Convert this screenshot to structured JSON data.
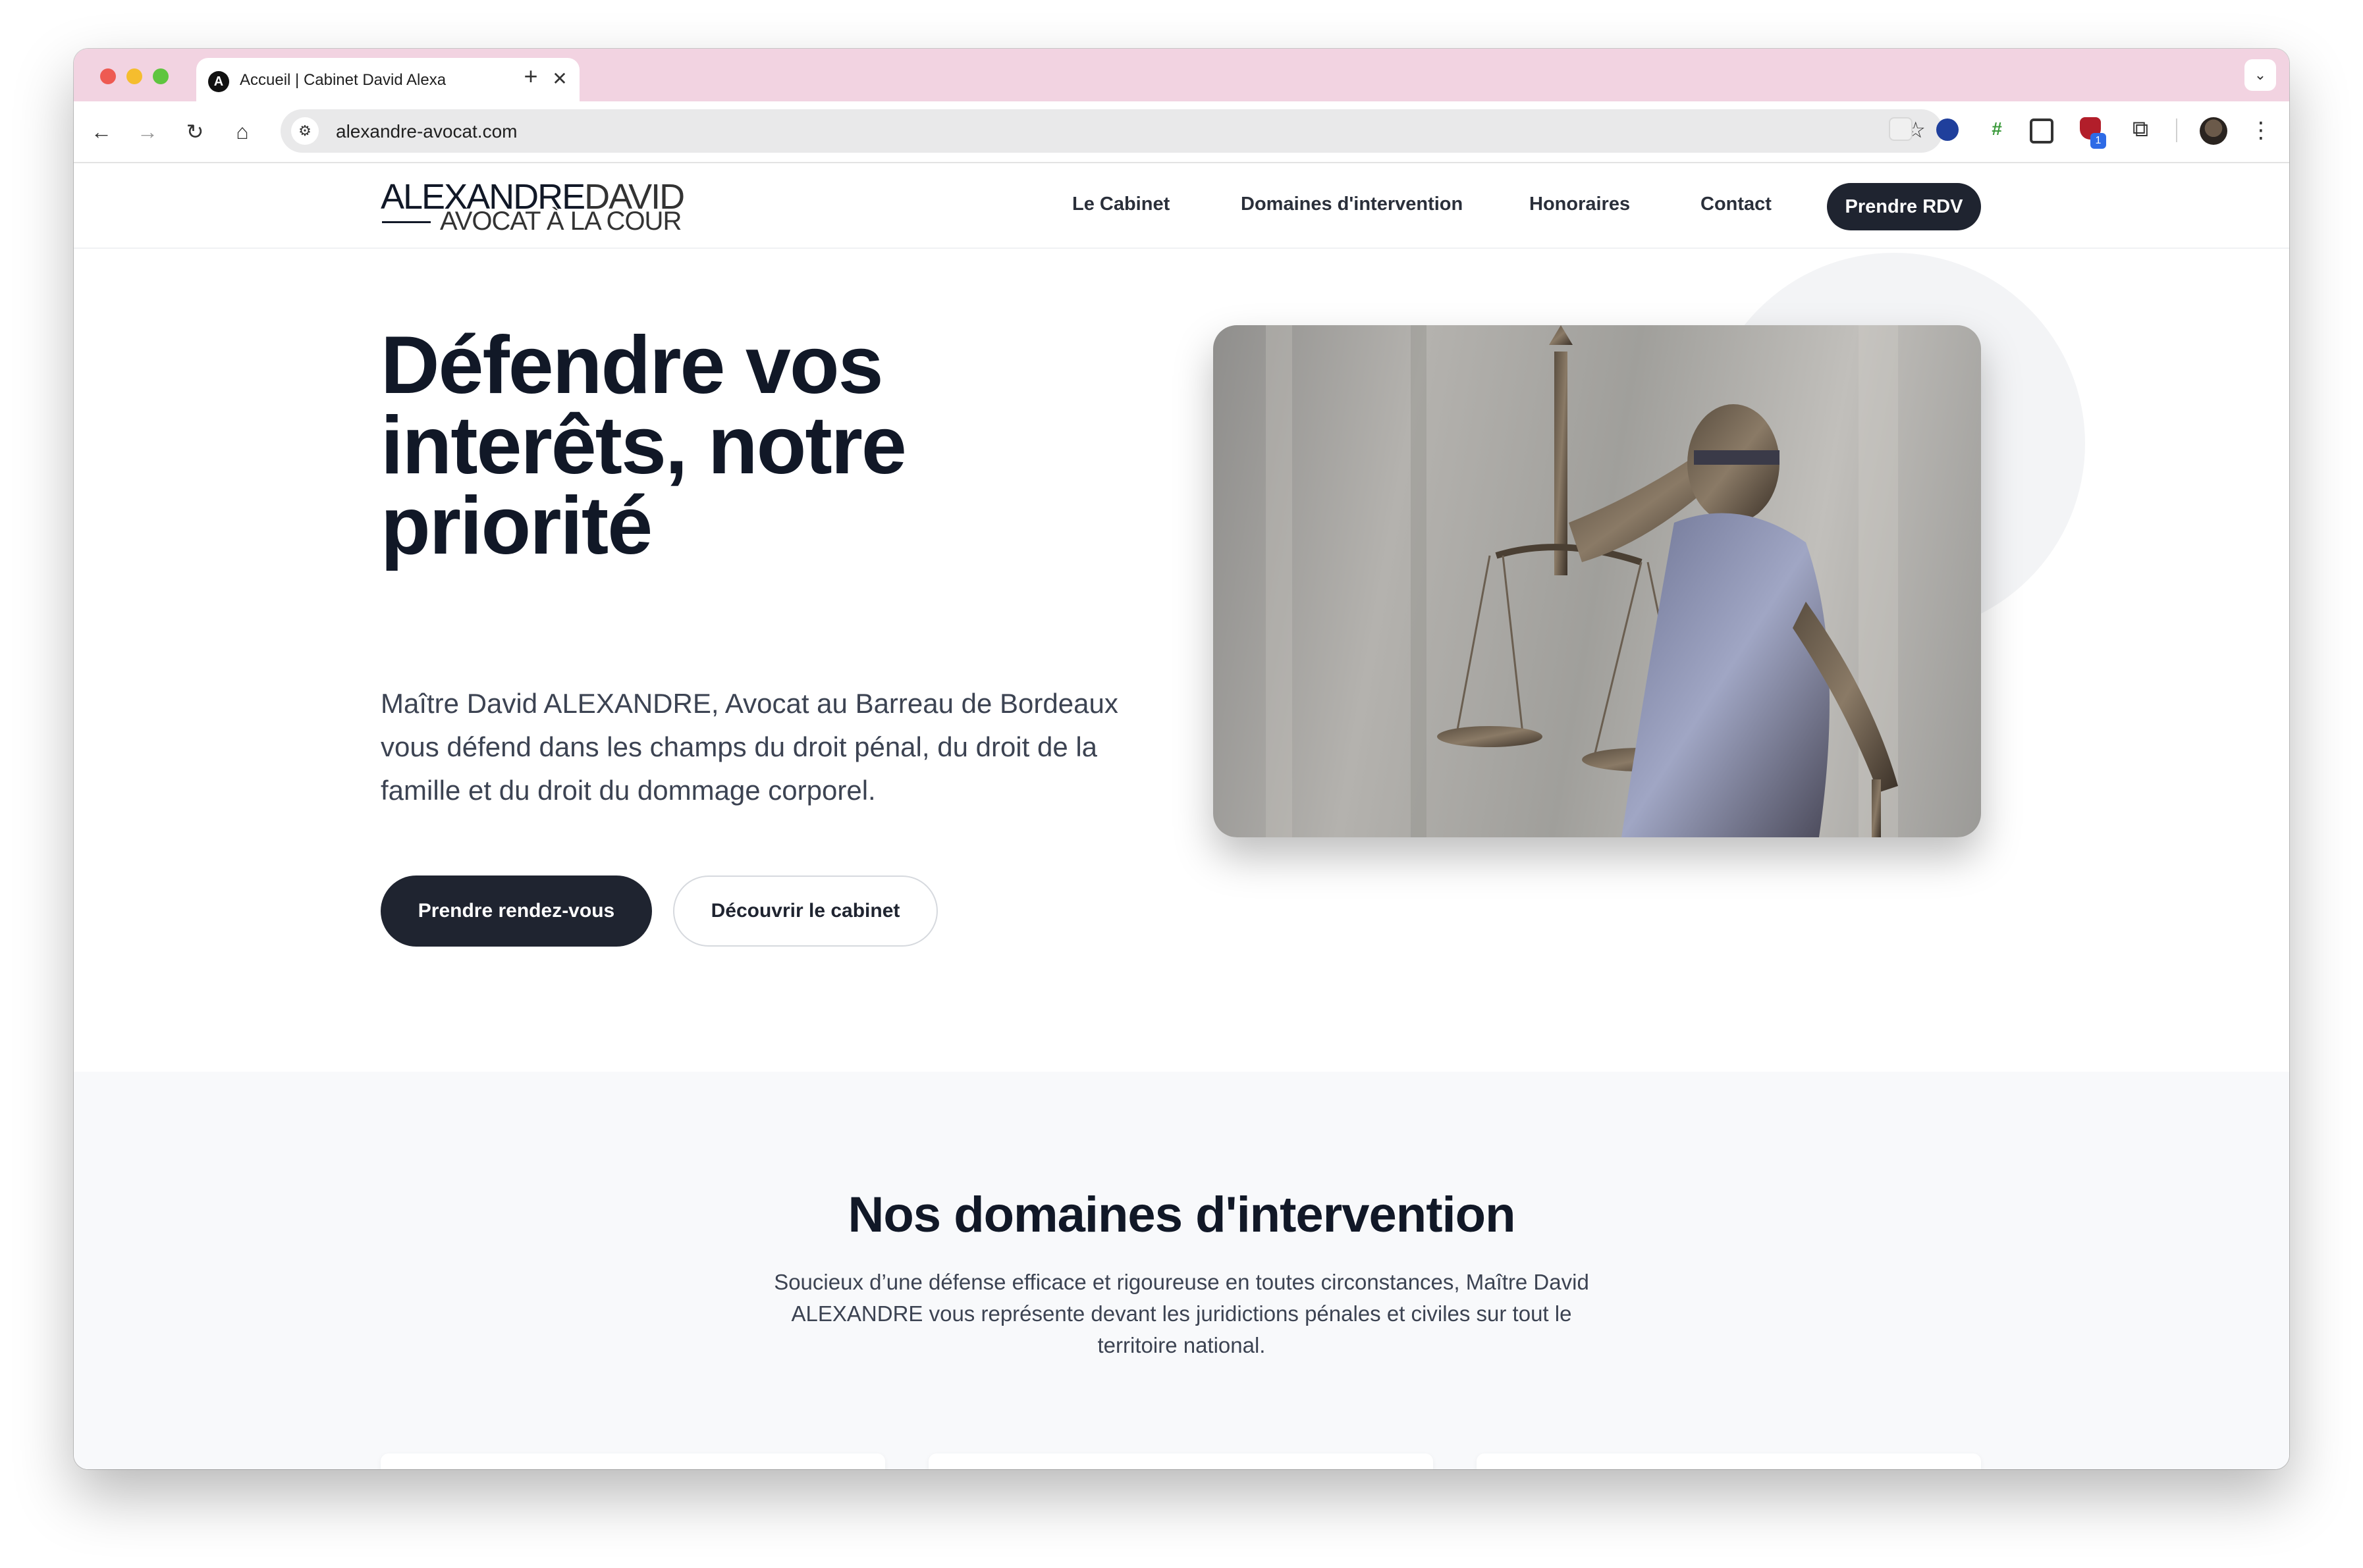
{
  "browser": {
    "tab_title": "Accueil | Cabinet David Alexa",
    "tab_favicon_letter": "A",
    "url": "alexandre-avocat.com"
  },
  "site": {
    "logo_name_bold": "ALEXANDRE",
    "logo_name_light": "DAVID",
    "logo_tagline": "AVOCAT À LA COUR",
    "nav": [
      {
        "label": "Le Cabinet"
      },
      {
        "label": "Domaines d'intervention"
      },
      {
        "label": "Honoraires"
      },
      {
        "label": "Contact"
      }
    ],
    "nav_cta": "Prendre RDV"
  },
  "hero": {
    "title": "Défendre vos interêts, notre priorité",
    "text": "Maître David ALEXANDRE, Avocat au Barreau de Bordeaux vous défend dans les champs du droit pénal, du droit de la famille et du droit du dommage corporel.",
    "primary_button": "Prendre rendez-vous",
    "secondary_button": "Découvrir le cabinet",
    "image_icon": "lady-justice-statue"
  },
  "domains": {
    "title": "Nos domaines d'intervention",
    "subtitle": "Soucieux d’une défense efficace et rigoureuse en toutes circonstances, Maître David ALEXANDRE vous représente devant les juridictions pénales et civiles sur tout le territoire national.",
    "cards": [
      {
        "icon": "gavel-icon"
      },
      {
        "icon": "hearts-icon"
      },
      {
        "icon": "shield-icon"
      }
    ]
  },
  "colors": {
    "tabstrip": "#f2d3e1",
    "dark_button": "#1f2430",
    "heading": "#111827",
    "section_bg": "#f8f9fb"
  }
}
